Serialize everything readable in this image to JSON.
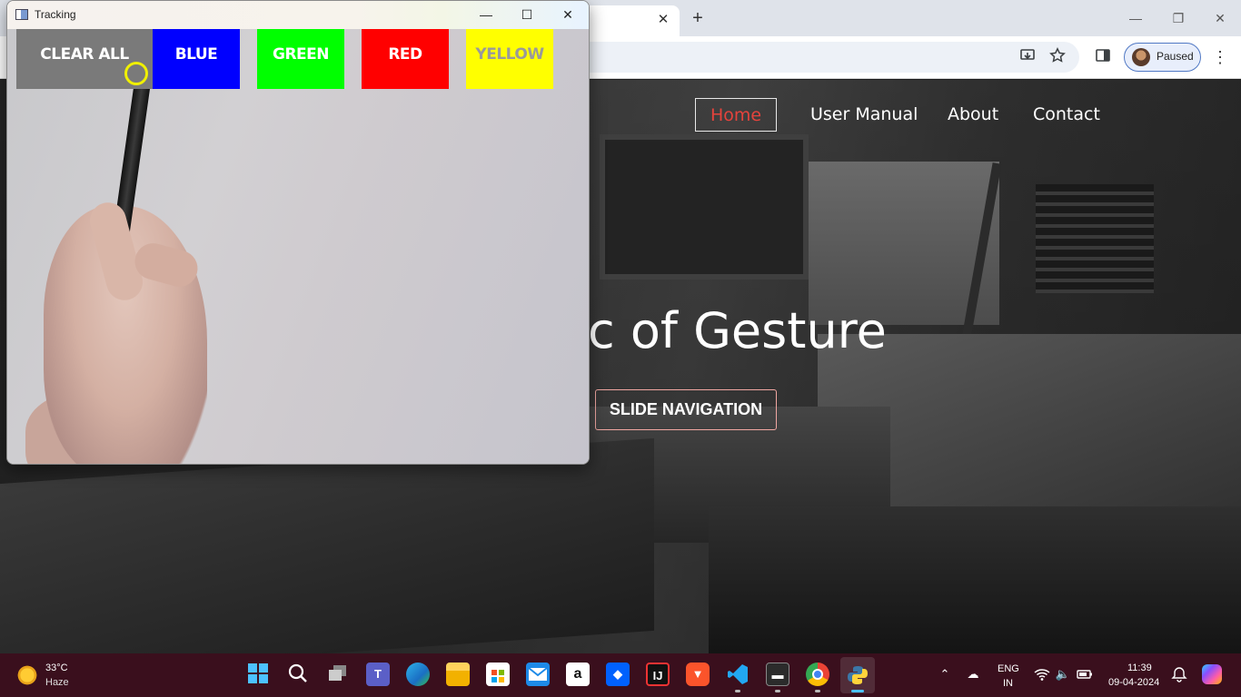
{
  "browser": {
    "tab_close_glyph": "✕",
    "new_tab_glyph": "+",
    "window_controls": {
      "minimize": "—",
      "restore": "❐",
      "close": "✕"
    },
    "profile_label": "Paused",
    "toolbar_icons": [
      "install-app-icon",
      "bookmark-star-icon",
      "side-panel-icon"
    ],
    "menu_glyph": "⋮"
  },
  "site": {
    "nav": [
      "Home",
      "User Manual",
      "About",
      "Contact"
    ],
    "active_nav": "Home",
    "hero_title": "c of Gesture",
    "hero_button": "SLIDE NAVIGATION",
    "colors": {
      "active_nav": "#e5433c",
      "button_border": "#f1a7a2"
    }
  },
  "tracking_window": {
    "title": "Tracking",
    "controls": {
      "minimize": "—",
      "maximize": "☐",
      "close": "✕"
    },
    "buttons": [
      {
        "label": "CLEAR ALL",
        "color": "#7a7a7a"
      },
      {
        "label": "BLUE",
        "color": "#0000ff"
      },
      {
        "label": "GREEN",
        "color": "#00ff00"
      },
      {
        "label": "RED",
        "color": "#ff0000"
      },
      {
        "label": "YELLOW",
        "color": "#ffff00"
      }
    ],
    "cursor_color": "#f0f000"
  },
  "taskbar": {
    "weather": {
      "temp": "33°C",
      "condition": "Haze"
    },
    "apps": [
      "start-icon",
      "search-icon",
      "task-view-icon",
      "teams-icon",
      "edge-icon",
      "file-explorer-icon",
      "ms-store-icon",
      "mail-icon",
      "amazon-icon",
      "dropbox-icon",
      "intellij-icon",
      "brave-icon",
      "vscode-icon",
      "terminal-icon",
      "chrome-icon",
      "python-icon"
    ],
    "tray": {
      "lang": "ENG",
      "region": "IN",
      "time": "11:39",
      "date": "09-04-2024"
    }
  }
}
